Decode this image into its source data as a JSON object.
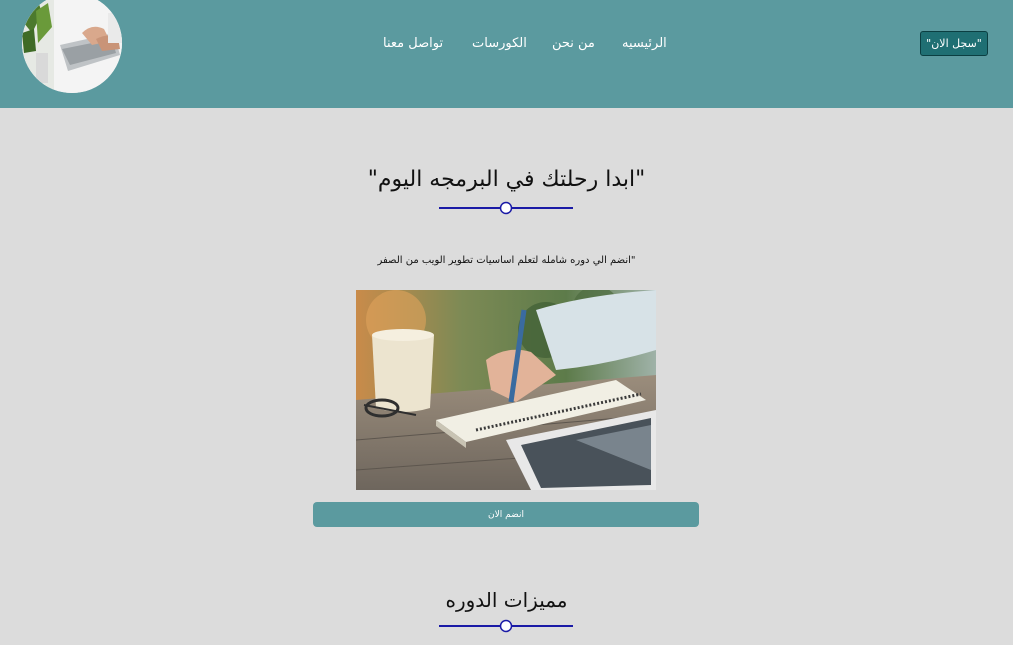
{
  "header": {
    "nav": [
      {
        "label": "الرئيسيه"
      },
      {
        "label": "من نحن"
      },
      {
        "label": "الكورسات"
      },
      {
        "label": "تواصل معنا"
      }
    ],
    "signup_label": "\"سجل الان\""
  },
  "hero": {
    "title": "\"ابدا رحلتك في البرمجه اليوم\"",
    "description": "انضم الي دوره شامله لتعلم اساسيات تطوير الويب من الصفر\"",
    "join_label": "انضم الان"
  },
  "features": {
    "title": "مميزات الدوره"
  },
  "colors": {
    "header_bg": "#5b9a9f",
    "signup_bg": "#1f6f73",
    "divider": "#1a1aa6",
    "page_bg": "#dcdcdc"
  }
}
